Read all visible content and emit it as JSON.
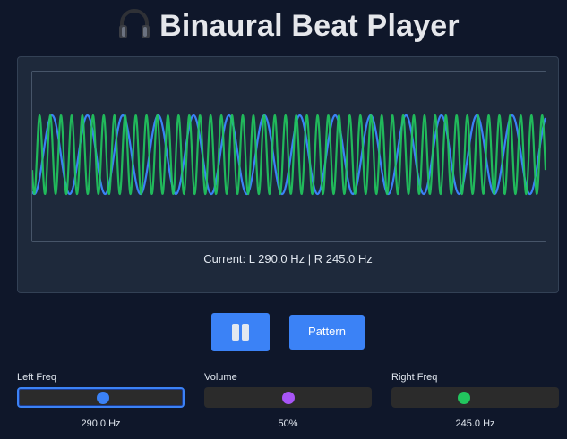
{
  "header": {
    "title": "Binaural Beat Player",
    "title_icon": "headphones-icon"
  },
  "visualizer": {
    "status": "Current: L 290.0 Hz | R 245.0 Hz",
    "left_wave_color": "#3b82f6",
    "right_wave_color": "#22c55e"
  },
  "controls": {
    "pause_icon": "pause-icon",
    "pattern_label": "Pattern"
  },
  "sliders": {
    "left": {
      "label": "Left Freq",
      "value_text": "290.0 Hz",
      "level": 0.5,
      "color": "#3b82f6"
    },
    "volume": {
      "label": "Volume",
      "value_text": "50%",
      "level": 0.5,
      "color": "#a855f7"
    },
    "right": {
      "label": "Right Freq",
      "value_text": "245.0 Hz",
      "level": 0.43,
      "color": "#22c55e"
    }
  }
}
